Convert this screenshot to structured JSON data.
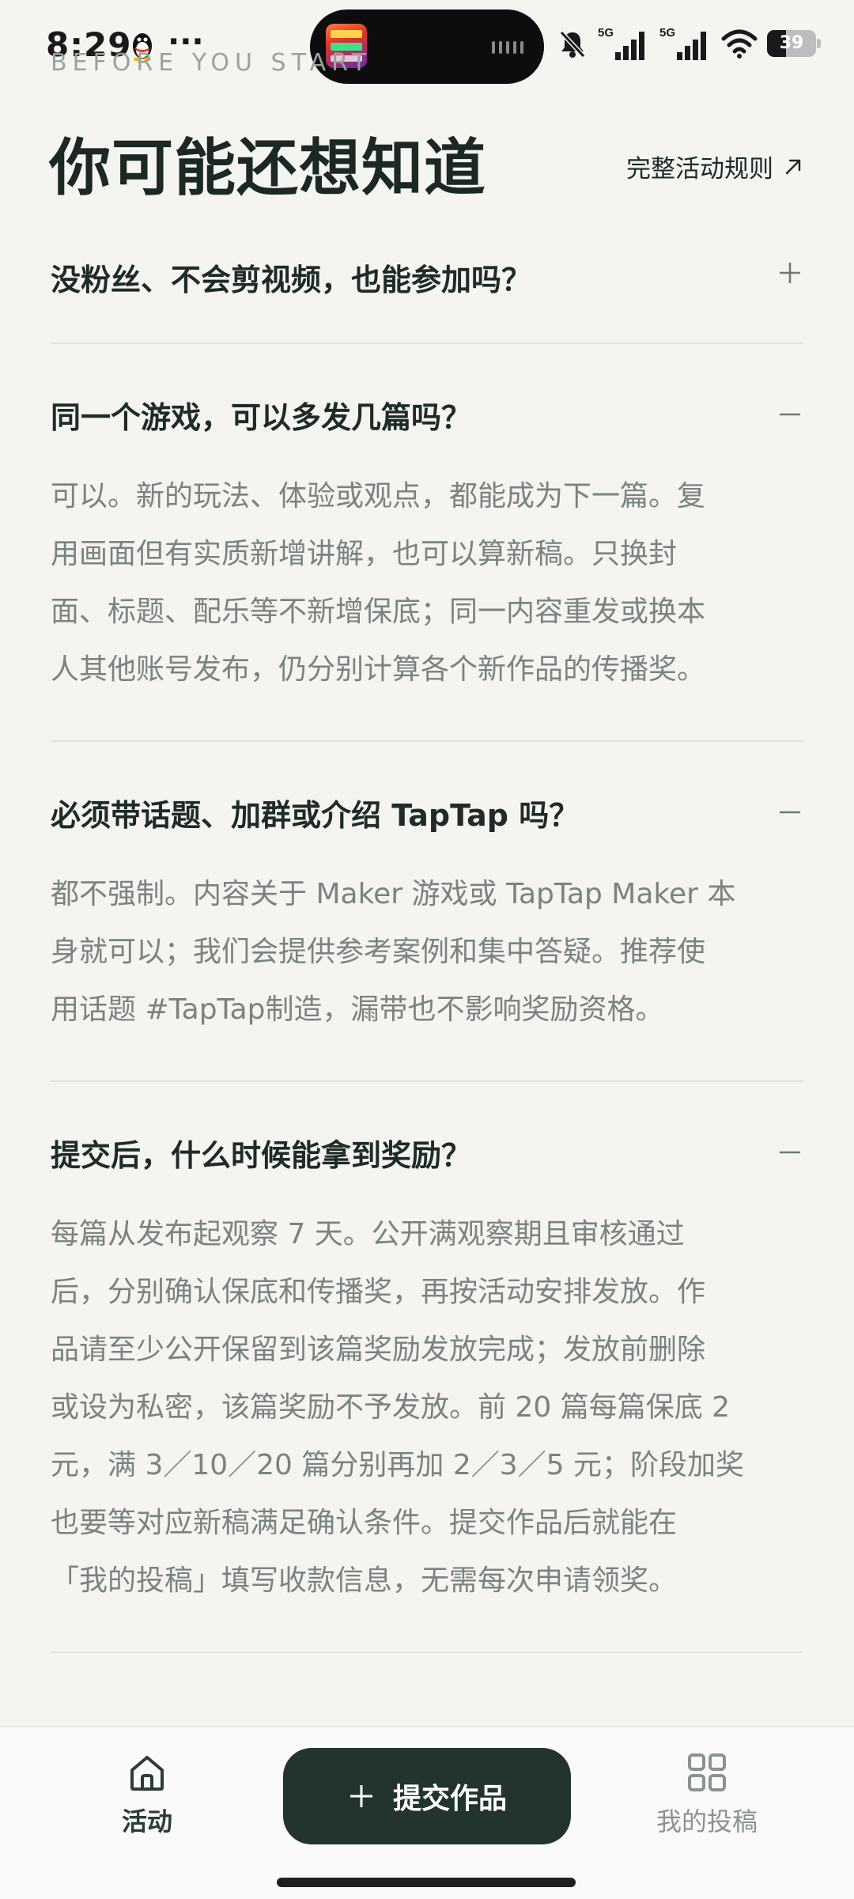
{
  "status_bar": {
    "time": "8:29",
    "overflow": "···",
    "network_1": "5G",
    "network_2": "5G",
    "battery": "39",
    "battery_level": 0.39
  },
  "header": {
    "eyebrow": "BEFORE YOU START",
    "title": "你可能还想知道",
    "rules_link": "完整活动规则"
  },
  "faq": [
    {
      "question": "没粉丝、不会剪视频，也能参加吗？",
      "expanded": false,
      "answer_lines": []
    },
    {
      "question": "同一个游戏，可以多发几篇吗？",
      "expanded": true,
      "answer_lines": [
        "可以。新的玩法、体验或观点，都能成为下一篇。复",
        "用画面但有实质新增讲解，也可以算新稿。只换封",
        "面、标题、配乐等不新增保底；同一内容重发或换本",
        "人其他账号发布，仍分别计算各个新作品的传播奖。"
      ]
    },
    {
      "question": "必须带话题、加群或介绍 TapTap 吗？",
      "expanded": true,
      "answer_lines": [
        "都不强制。内容关于 Maker 游戏或 TapTap Maker 本",
        "身就可以；我们会提供参考案例和集中答疑。推荐使",
        "用话题 #TapTap制造，漏带也不影响奖励资格。"
      ]
    },
    {
      "question": "提交后，什么时候能拿到奖励？",
      "expanded": true,
      "answer_lines": [
        "每篇从发布起观察 7 天。公开满观察期且审核通过",
        "后，分别确认保底和传播奖，再按活动安排发放。作",
        "品请至少公开保留到该篇奖励发放完成；发放前删除",
        "或设为私密，该篇奖励不予发放。前 20 篇每篇保底 2",
        "元，满 3／10／20 篇分别再加 2／3／5 元；阶段加奖",
        "也要等对应新稿满足确认条件。提交作品后就能在",
        "「我的投稿」填写收款信息，无需每次申请领奖。"
      ]
    }
  ],
  "bottom_nav": {
    "activity": "活动",
    "submit": "提交作品",
    "my_submissions": "我的投稿"
  },
  "colors": {
    "background": "#f4f4f1",
    "primary_dark": "#22342b",
    "muted_text": "#7b837e"
  }
}
